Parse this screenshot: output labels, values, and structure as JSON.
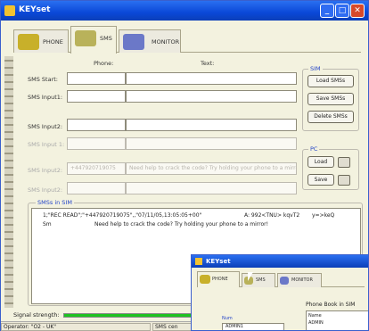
{
  "window": {
    "title": "KEYset"
  },
  "tabs": [
    {
      "label": "PHONE"
    },
    {
      "label": "SMS"
    },
    {
      "label": "MONITOR"
    }
  ],
  "headers": {
    "phone": "Phone:",
    "text": "Text:"
  },
  "fields": [
    {
      "label": "SMS Start:",
      "phone": "",
      "text": ""
    },
    {
      "label": "SMS Input1:",
      "phone": "",
      "text": ""
    },
    {
      "label": "SMS Input2:",
      "phone": "",
      "text": ""
    },
    {
      "label": "SMS Input 1:",
      "phone": "",
      "text": ""
    },
    {
      "label": "SMS Input2:",
      "phone": "+447920719075",
      "text": "Need help to crack the code? Try holding your phone to a mirror!"
    },
    {
      "label": "SMS Input2:",
      "phone": "",
      "text": ""
    }
  ],
  "sim": {
    "title": "SIM",
    "load": "Load SMSs",
    "save": "Save SMSs",
    "delete": "Delete SMSs"
  },
  "pc": {
    "title": "PC",
    "load": "Load",
    "save": "Save"
  },
  "sms_in_sim": {
    "title": "SMSs in SIM",
    "rows": [
      {
        "a": "1;\"REC READ\";\"+447920719075\",,\"07/11/05,13:05:05+00\"",
        "b": "A: 992<TNU> kqvT2",
        "c": "y=>keQ"
      },
      {
        "a": "Sm",
        "b": "Need help to crack the code? Try holding your phone to a mirror!",
        "c": ""
      }
    ]
  },
  "signal": {
    "label": "Signal strength:",
    "level": 0.75
  },
  "status": {
    "operator": "Operator: \"O2 - UK\"",
    "sms": "SMS cen"
  },
  "window2": {
    "title": "KEYset",
    "tabs": [
      {
        "label": "PHONE"
      },
      {
        "label": "SMS"
      },
      {
        "label": "MONITOR"
      }
    ],
    "phonebook": "Phone Book in SIM",
    "col_name": "Name",
    "col_num": "Num",
    "entry": "ADMIN1",
    "entry2": "ADMIN"
  },
  "colors": {
    "title": "#0a48d8",
    "signal": "#1ec320",
    "accent": "#2545c8"
  }
}
